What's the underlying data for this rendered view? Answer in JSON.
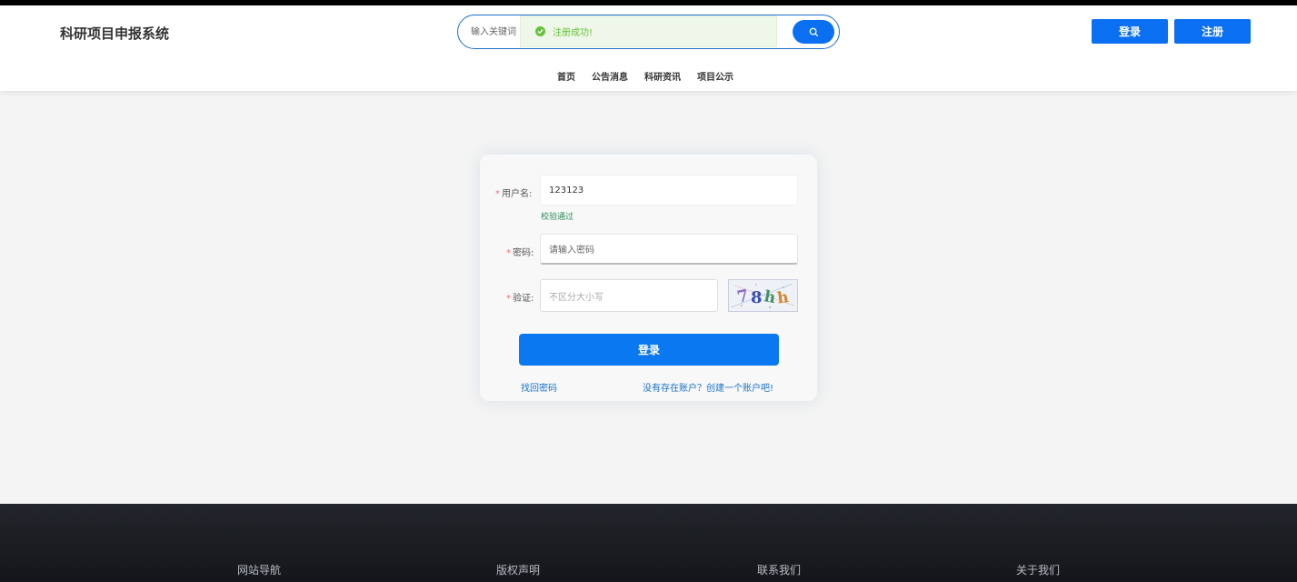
{
  "header": {
    "site_title": "科研项目申报系统",
    "search_placeholder": "输入关键词",
    "login_label": "登录",
    "register_label": "注册"
  },
  "toast": {
    "message": "注册成功!"
  },
  "nav": {
    "items": [
      "首页",
      "公告消息",
      "科研资讯",
      "项目公示"
    ]
  },
  "login_form": {
    "username_label": "用户名:",
    "username_value": "123123",
    "username_valid": "校验通过",
    "password_label": "密码:",
    "password_placeholder": "请输入密码",
    "captcha_label": "验证:",
    "captcha_placeholder": "不区分大小写",
    "captcha_text": "78hh",
    "submit_label": "登录",
    "forgot_link": "找回密码",
    "create_link": "没有存在账户？创建一个账户吧!"
  },
  "footer": {
    "columns": [
      "网站导航",
      "版权声明",
      "联系我们",
      "关于我们"
    ]
  },
  "colors": {
    "primary": "#0a6ff0",
    "success": "#67c23a",
    "required": "#f56c6c"
  }
}
